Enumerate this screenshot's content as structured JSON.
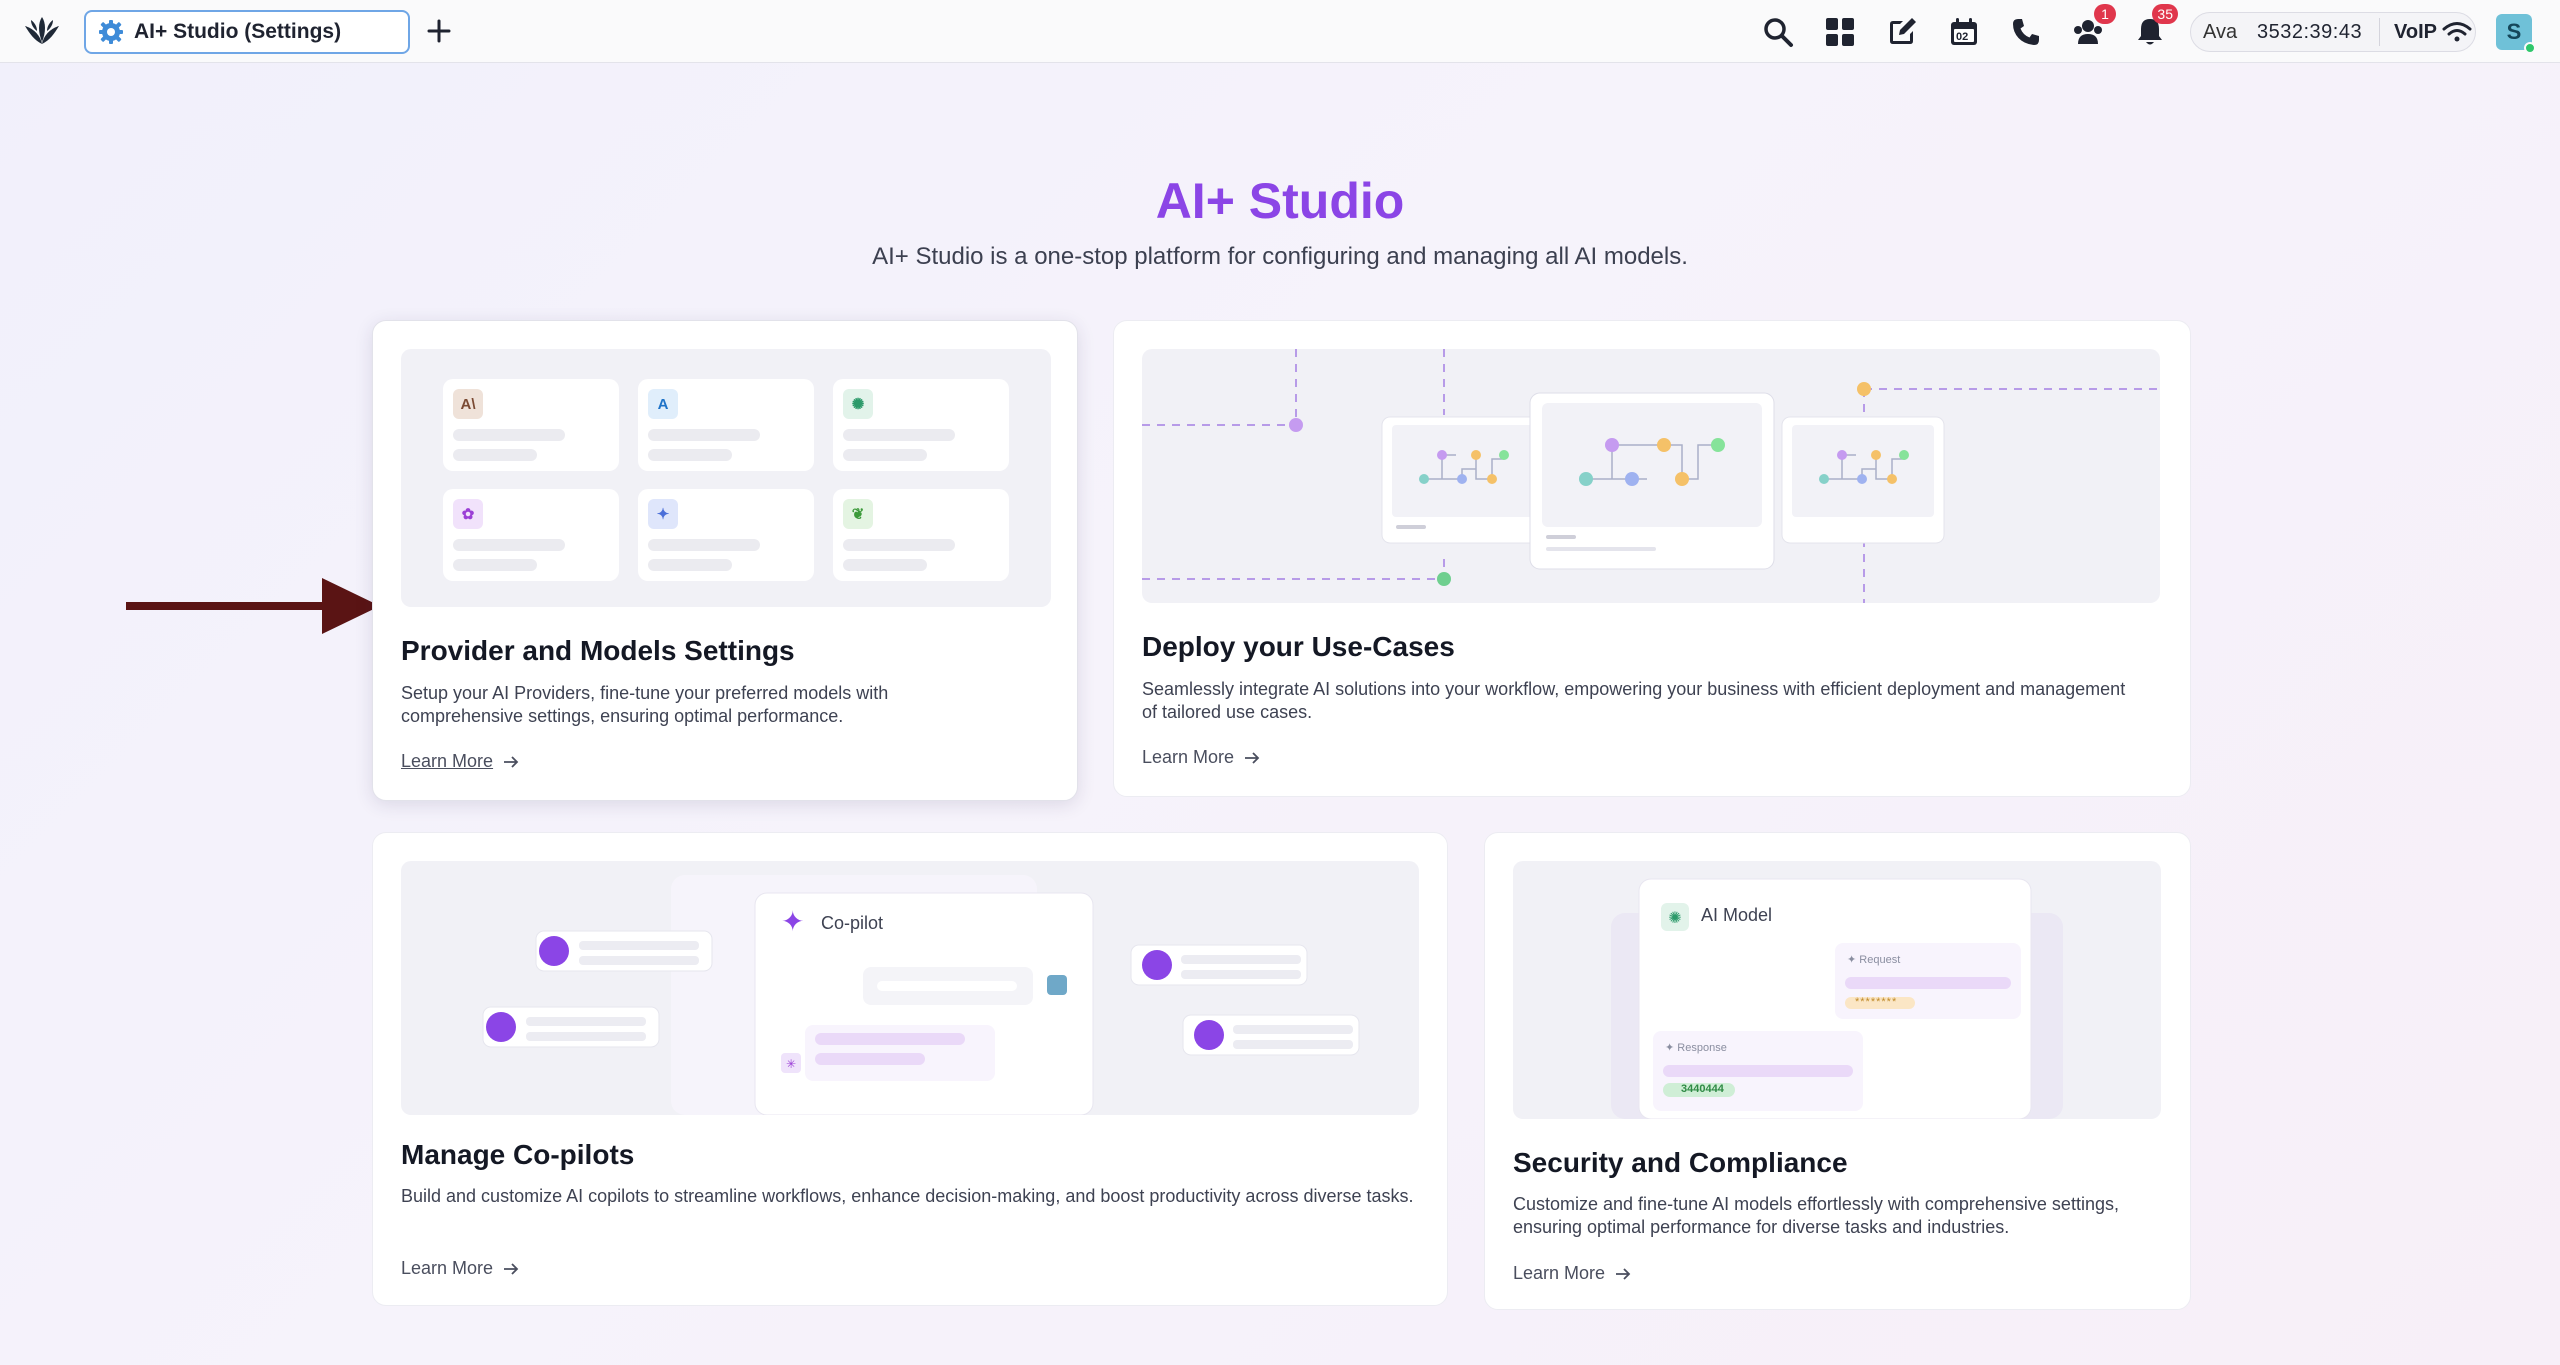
{
  "topbar": {
    "tab_title": "AI+ Studio (Settings)",
    "notifications_count": "1",
    "alerts_count": "35",
    "calendar_day": "02",
    "status": {
      "user": "Ava",
      "timer": "3532:39:43",
      "voip": "VoIP"
    },
    "avatar_letter": "S"
  },
  "hero": {
    "title": "AI+ Studio",
    "subtitle": "AI+ Studio is a one-stop platform for configuring and managing all AI models."
  },
  "cards": {
    "providers": {
      "title": "Provider and Models Settings",
      "description": "Setup your AI Providers, fine-tune your preferred models with comprehensive settings, ensuring optimal performance.",
      "link": "Learn More"
    },
    "deploy": {
      "title": "Deploy your Use-Cases",
      "description": "Seamlessly integrate AI solutions into your workflow, empowering your business with efficient deployment and management of tailored use cases.",
      "link": "Learn More"
    },
    "copilots": {
      "title": "Manage Co-pilots",
      "description": "Build and customize AI copilots to streamline workflows, enhance decision-making, and boost productivity across diverse tasks.",
      "link": "Learn More",
      "illustration_label": "Co-pilot"
    },
    "security": {
      "title": "Security and Compliance",
      "description": "Customize and fine-tune AI models effortlessly with comprehensive settings, ensuring optimal performance for diverse tasks and industries.",
      "link": "Learn More",
      "illustration_label": "AI Model",
      "request_label": "Request",
      "request_value": "********",
      "response_label": "Response",
      "response_value": "3440444"
    }
  },
  "colors": {
    "accent": "#8b45e6",
    "badge": "#e0364c",
    "arrow": "#5a1414"
  }
}
